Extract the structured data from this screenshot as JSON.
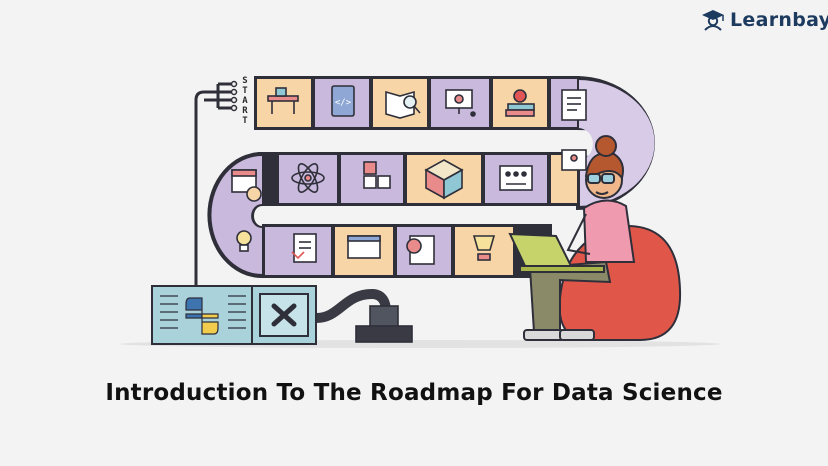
{
  "logo": {
    "text": "Learnbay",
    "icon": "graduate-icon",
    "color": "#1d3a5f"
  },
  "board": {
    "start_letters": [
      "S",
      "T",
      "A",
      "R",
      "T"
    ],
    "tile_colors": {
      "orange": "#f7d5a6",
      "purple": "#c9b9dd",
      "outline": "#2f2f3a"
    },
    "row1_icons": [
      "desk-icon",
      "code-book-icon",
      "book-search-icon",
      "monitor-camera-icon",
      "books-apple-icon",
      "notebook-icon"
    ],
    "row2_icons": [
      "calendar-clock-icon",
      "atom-icon",
      "blocks-icon",
      "cube-icon",
      "dashboard-icon",
      "video-call-icon"
    ],
    "row3_icons": [
      "lightbulb-icon",
      "download-doc-icon",
      "browser-window-icon",
      "a-plus-grade-icon",
      "trophy-icon"
    ],
    "python_box_icon": "python-logo-icon",
    "x_box_icon": "close-icon"
  },
  "caption": {
    "title": "Introduction To The Roadmap For Data Science"
  }
}
